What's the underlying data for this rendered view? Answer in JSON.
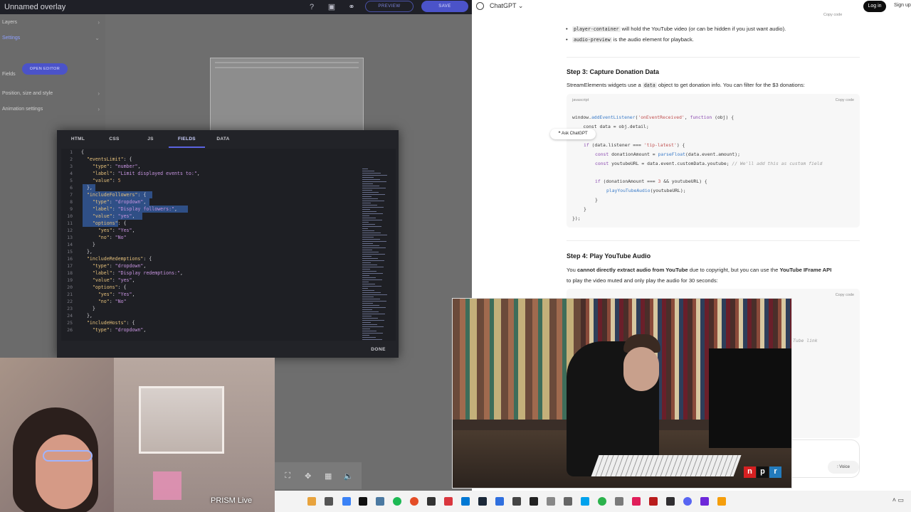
{
  "se": {
    "title": "Unnamed overlay",
    "preview_label": "PREVIEW",
    "save_label": "SAVE",
    "sidebar": {
      "layers": "Layers",
      "settings": "Settings",
      "open_editor": "OPEN EDITOR",
      "fields": "Fields",
      "position": "Position, size and style",
      "animation": "Animation settings"
    },
    "modal": {
      "tabs": [
        "HTML",
        "CSS",
        "JS",
        "FIELDS",
        "DATA"
      ],
      "active_tab": "FIELDS",
      "done_label": "DONE",
      "line_numbers": [
        "1",
        "2",
        "3",
        "4",
        "5",
        "6",
        "7",
        "8",
        "9",
        "10",
        "11",
        "12",
        "13",
        "14",
        "15",
        "16",
        "17",
        "18",
        "19",
        "20",
        "21",
        "22",
        "23",
        "24",
        "25",
        "26"
      ]
    }
  },
  "prism_label": "PRISM Live",
  "gpt": {
    "brand": "ChatGPT",
    "login": "Log in",
    "signup": "Sign up",
    "copy_code": "Copy code",
    "lang": "javascript",
    "bullet1_code": "player-container",
    "bullet1_text": "will hold the YouTube video (or can be hidden if you just want audio).",
    "bullet2_code": "audio-preview",
    "bullet2_text": "is the audio element for playback.",
    "step3_title": "Step 3: Capture Donation Data",
    "step3_p1": "StreamElements widgets use a",
    "step3_code": "data",
    "step3_p2": "object to get donation info. You can filter for the $3 donations:",
    "ask_chatgpt": "Ask ChatGPT",
    "step4_title": "Step 4: Play YouTube Audio",
    "step4_p1a": "You",
    "step4_p1b": "cannot directly extract audio from YouTube",
    "step4_p1c": "due to copyright, but you can use the",
    "step4_p1d": "YouTube IFrame API",
    "step4_p2": "to play the video muted and only play the audio for 30 seconds:",
    "partial_comment": "Tube link",
    "voice": "Voice"
  },
  "npr": [
    "n",
    "p",
    "r"
  ]
}
